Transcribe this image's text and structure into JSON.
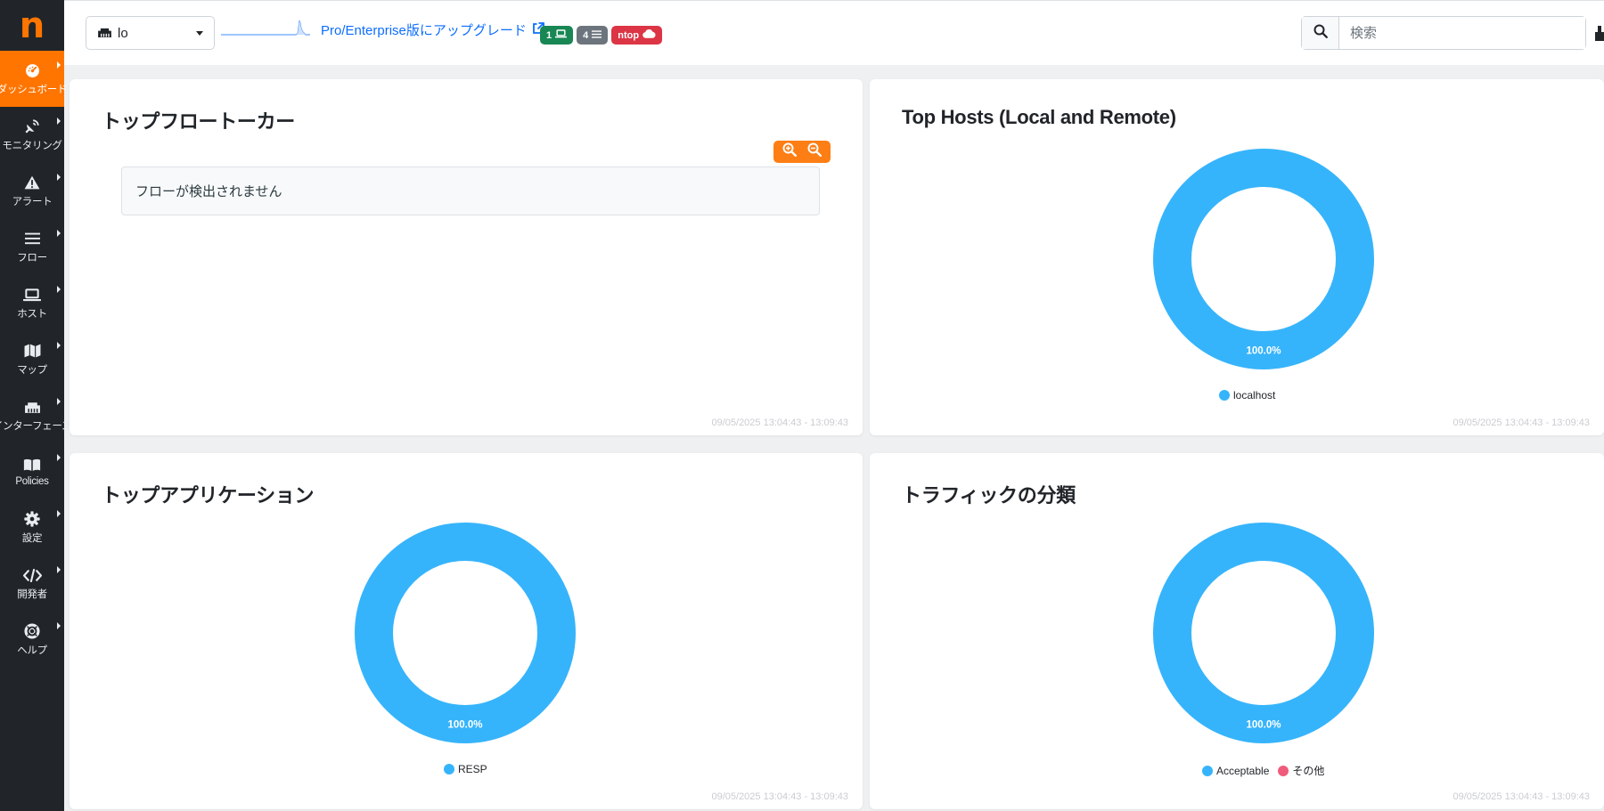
{
  "app": {
    "logo_letter": "n"
  },
  "colors": {
    "accent": "#ff7500",
    "sidebar_bg": "#212529",
    "chart_blue": "#36b4fb",
    "chart_pink": "#ef5b7b",
    "link": "#0d6efd"
  },
  "sidebar": {
    "items": [
      {
        "label": "ダッシュボード",
        "icon": "speedometer-icon",
        "active": true
      },
      {
        "label": "モニタリング",
        "icon": "satellite-dish-icon"
      },
      {
        "label": "アラート",
        "icon": "warning-triangle-icon"
      },
      {
        "label": "フロー",
        "icon": "list-lines-icon"
      },
      {
        "label": "ホスト",
        "icon": "laptop-icon"
      },
      {
        "label": "マップ",
        "icon": "map-icon"
      },
      {
        "label": "インターフェース",
        "icon": "ethernet-icon"
      },
      {
        "label": "Policies",
        "icon": "book-icon"
      },
      {
        "label": "設定",
        "icon": "gear-icon"
      },
      {
        "label": "開発者",
        "icon": "code-icon"
      },
      {
        "label": "ヘルプ",
        "icon": "lifebuoy-icon"
      }
    ]
  },
  "topbar": {
    "interface": {
      "value": "lo",
      "icon": "ethernet-icon"
    },
    "upgrade_link": "Pro/Enterprise版にアップグレード",
    "badges": [
      {
        "count": "1",
        "icon": "laptop-icon",
        "color": "#198754"
      },
      {
        "count": "4",
        "icon": "list-lines-icon",
        "color": "#6c757d"
      },
      {
        "count": "ntop",
        "icon": "cloud-icon",
        "color": "#dc3545"
      }
    ],
    "search": {
      "placeholder": "検索"
    }
  },
  "cards": {
    "top_flow_talkers": {
      "title": "トップフロートーカー",
      "empty_message": "フローが検出されません",
      "timestamp": "09/05/2025 13:04:43 - 13:09:43"
    },
    "top_hosts": {
      "title": "Top Hosts (Local and Remote)",
      "timestamp": "09/05/2025 13:04:43 - 13:09:43"
    },
    "top_applications": {
      "title": "トップアプリケーション",
      "timestamp": "09/05/2025 13:04:43 - 13:09:43"
    },
    "traffic_classification": {
      "title": "トラフィックの分類",
      "timestamp": "09/05/2025 13:04:43 - 13:09:43"
    }
  },
  "chart_data": [
    {
      "type": "pie",
      "title": "Top Hosts (Local and Remote)",
      "categories": [
        "localhost"
      ],
      "values": [
        100.0
      ],
      "labels": [
        "100.0%"
      ],
      "colors": [
        "#36b4fb"
      ],
      "legend": "bottom"
    },
    {
      "type": "pie",
      "title": "トップアプリケーション",
      "categories": [
        "RESP"
      ],
      "values": [
        100.0
      ],
      "labels": [
        "100.0%"
      ],
      "colors": [
        "#36b4fb"
      ],
      "legend": "bottom"
    },
    {
      "type": "pie",
      "title": "トラフィックの分類",
      "categories": [
        "Acceptable",
        "その他"
      ],
      "values": [
        100.0,
        0.0
      ],
      "labels": [
        "100.0%"
      ],
      "colors": [
        "#36b4fb",
        "#ef5b7b"
      ],
      "legend": "bottom"
    }
  ]
}
